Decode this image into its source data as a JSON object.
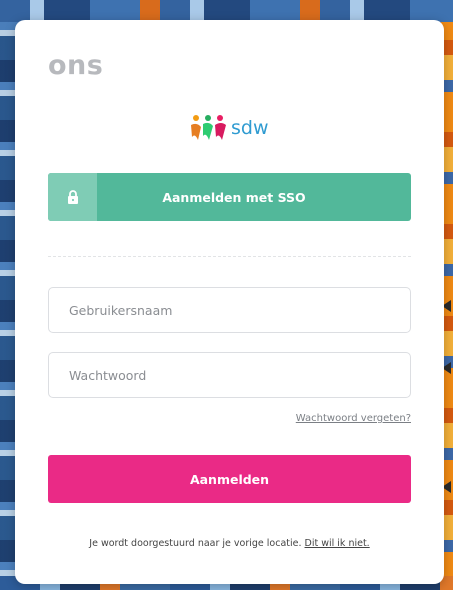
{
  "header": {
    "app_logo_text": "ons",
    "partner_logo_text": "sdw"
  },
  "sso": {
    "label": "Aanmelden met SSO",
    "icon": "lock-icon"
  },
  "form": {
    "username_placeholder": "Gebruikersnaam",
    "password_placeholder": "Wachtwoord",
    "forgot_password_label": "Wachtwoord vergeten?",
    "submit_label": "Aanmelden"
  },
  "redirect": {
    "message": "Je wordt doorgestuurd naar je vorige locatie.",
    "opt_out_label": "Dit wil ik niet."
  },
  "colors": {
    "sso_button": "#52b89a",
    "sso_icon_bg": "#7fccb5",
    "login_button": "#ea2a86",
    "logo_gray": "#b7b9bd",
    "partner_blue": "#2f9bd1"
  }
}
